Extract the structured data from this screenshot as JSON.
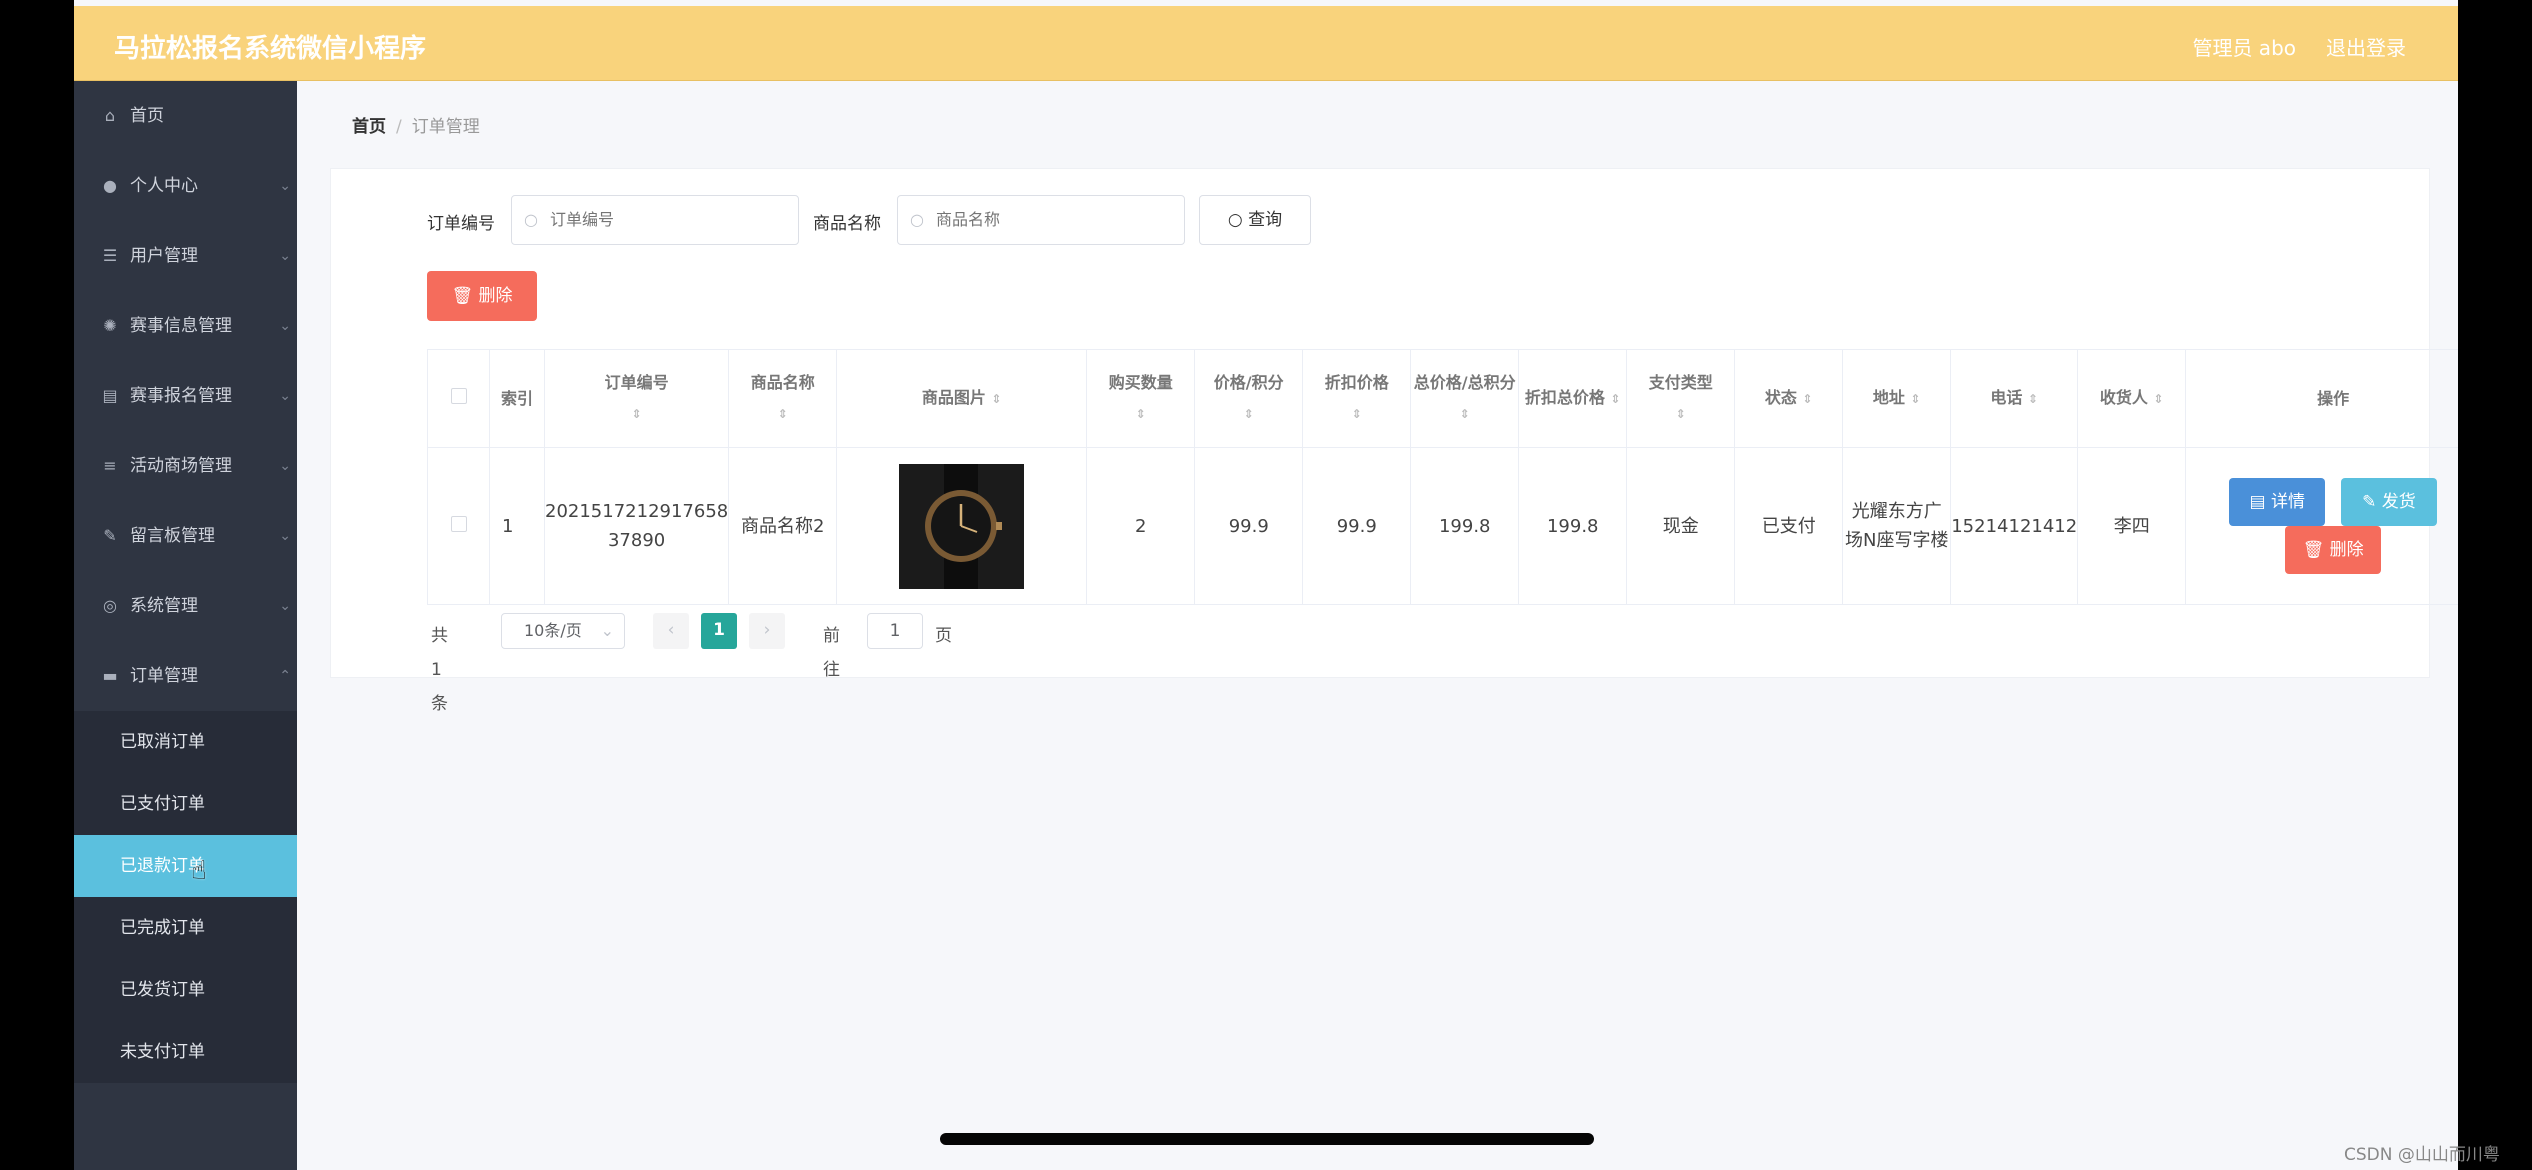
{
  "app_title": "马拉松报名系统微信小程序",
  "header": {
    "admin": "管理员 abo",
    "logout": "退出登录"
  },
  "sidebar": {
    "items": [
      {
        "label": "首页",
        "icon": "home-icon"
      },
      {
        "label": "个人中心",
        "icon": "user-icon"
      },
      {
        "label": "用户管理",
        "icon": "list-icon"
      },
      {
        "label": "赛事信息管理",
        "icon": "settings-icon"
      },
      {
        "label": "赛事报名管理",
        "icon": "clipboard-icon"
      },
      {
        "label": "活动商场管理",
        "icon": "sliders-icon"
      },
      {
        "label": "留言板管理",
        "icon": "chat-icon"
      },
      {
        "label": "系统管理",
        "icon": "gear-icon"
      },
      {
        "label": "订单管理",
        "icon": "monitor-icon"
      }
    ],
    "sub_items": [
      "已取消订单",
      "已支付订单",
      "已退款订单",
      "已完成订单",
      "已发货订单",
      "未支付订单"
    ],
    "active_sub": "已退款订单"
  },
  "breadcrumb": {
    "home": "首页",
    "sep": "/",
    "current": "订单管理"
  },
  "search": {
    "order_no_label": "订单编号",
    "order_no_placeholder": "订单编号",
    "product_name_label": "商品名称",
    "product_name_placeholder": "商品名称",
    "query_button": "查询"
  },
  "delete_button": "删除",
  "table": {
    "headers": [
      "索引",
      "订单编号",
      "商品名称",
      "商品图片",
      "购买数量",
      "价格/积分",
      "折扣价格",
      "总价格/总积分",
      "折扣总价格",
      "支付类型",
      "状态",
      "地址",
      "电话",
      "收货人",
      "操作"
    ],
    "rows": [
      {
        "index": "1",
        "order_no": "2021517212917658 37890",
        "product_name": "商品名称2",
        "quantity": "2",
        "price": "99.9",
        "discount_price": "99.9",
        "total_price": "199.8",
        "discount_total": "199.8",
        "pay_type": "现金",
        "status": "已支付",
        "address": "光耀东方广场N座写字楼",
        "phone": "15214121412",
        "receiver": "李四"
      }
    ],
    "actions": {
      "detail": "详情",
      "ship": "发货",
      "delete": "删除"
    }
  },
  "pagination": {
    "total": "共 1 条",
    "page_size": "10条/页",
    "current_page": "1",
    "goto_prefix": "前往",
    "goto_value": "1",
    "goto_suffix": "页"
  },
  "credit": "CSDN @山山而川粤",
  "colors": {
    "header": "#f9d37c",
    "sidebar": "#2f3542",
    "active": "#5bc0de",
    "danger": "#f56c5c",
    "primary": "#4a90d9",
    "success": "#26a69a"
  }
}
